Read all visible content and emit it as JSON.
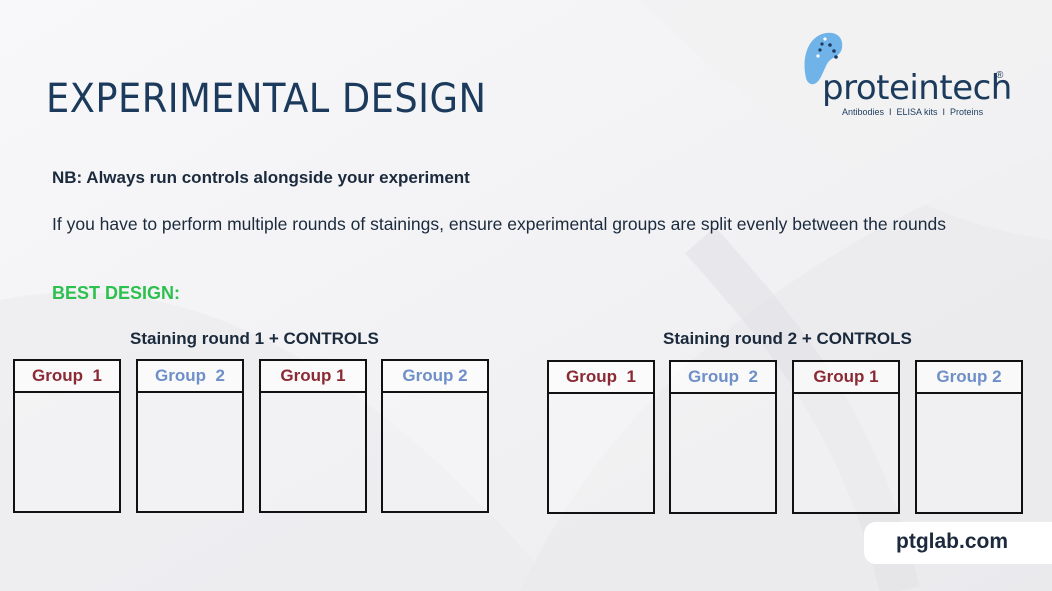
{
  "slide": {
    "title": "EXPERIMENTAL DESIGN",
    "note": "NB: Always run controls alongside your experiment",
    "advice": "If you have to perform multiple rounds of stainings, ensure experimental groups are split evenly between the rounds",
    "best_design_label": "BEST DESIGN:",
    "rounds": [
      {
        "label": "Staining round 1 + CONTROLS",
        "groups": [
          "Group  1",
          "Group  2",
          "Group 1",
          "Group 2"
        ]
      },
      {
        "label": "Staining round 2 + CONTROLS",
        "groups": [
          "Group  1",
          "Group  2",
          "Group 1",
          "Group 2"
        ]
      }
    ],
    "colors": {
      "title": "#1b3a5c",
      "best_design": "#2ec04f",
      "group1": "#8b2a35",
      "group2": "#6f8fc8"
    }
  },
  "logo": {
    "brand": "proteintech",
    "registered_mark": "®",
    "tagline": "Antibodies  I  ELISA kits  I  Proteins",
    "icon": "tooth-dots-icon"
  },
  "footer": {
    "url": "ptglab.com"
  }
}
